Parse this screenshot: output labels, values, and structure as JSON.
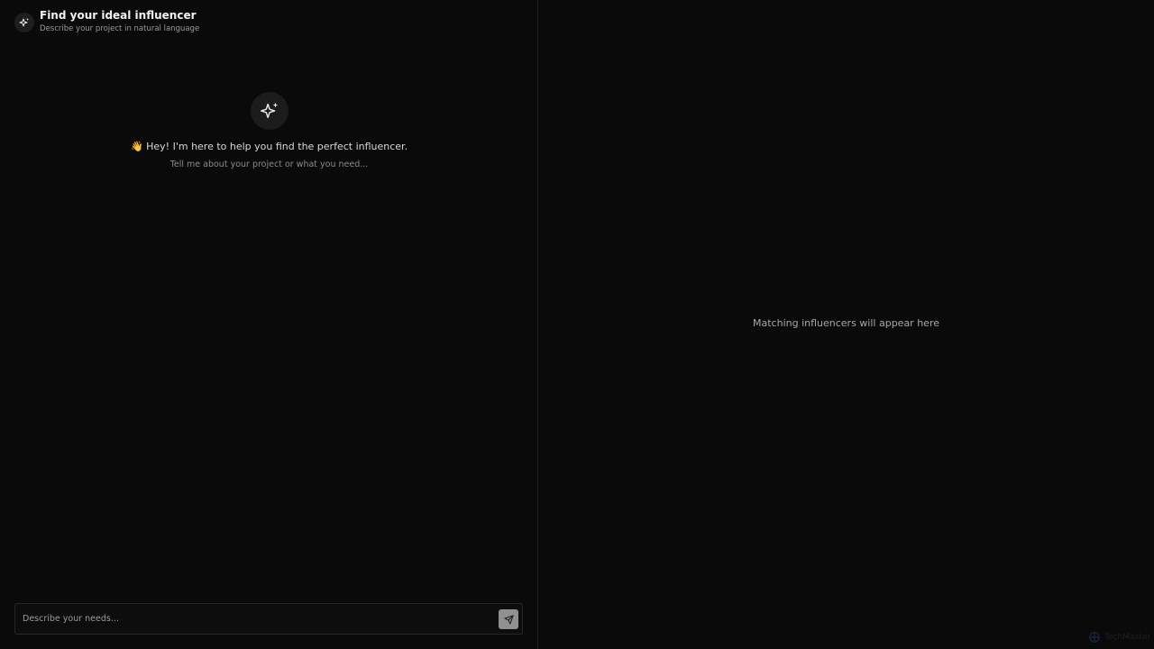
{
  "chat": {
    "header": {
      "title": "Find your ideal influencer",
      "subtitle": "Describe your project in natural language",
      "icon": "sparkles-icon"
    },
    "welcome": {
      "icon": "sparkles-icon",
      "title": "👋 Hey! I'm here to help you find the perfect influencer.",
      "subtitle": "Tell me about your project or what you need..."
    },
    "composer": {
      "placeholder": "Describe your needs...",
      "value": "",
      "send_icon": "send-icon"
    }
  },
  "results": {
    "empty_text": "Matching influencers will appear here"
  },
  "watermark": {
    "text": "TechMaster"
  },
  "colors": {
    "background": "#0a0a0a",
    "panel_border": "#1f1f1f",
    "send_button": "#8e918e"
  }
}
